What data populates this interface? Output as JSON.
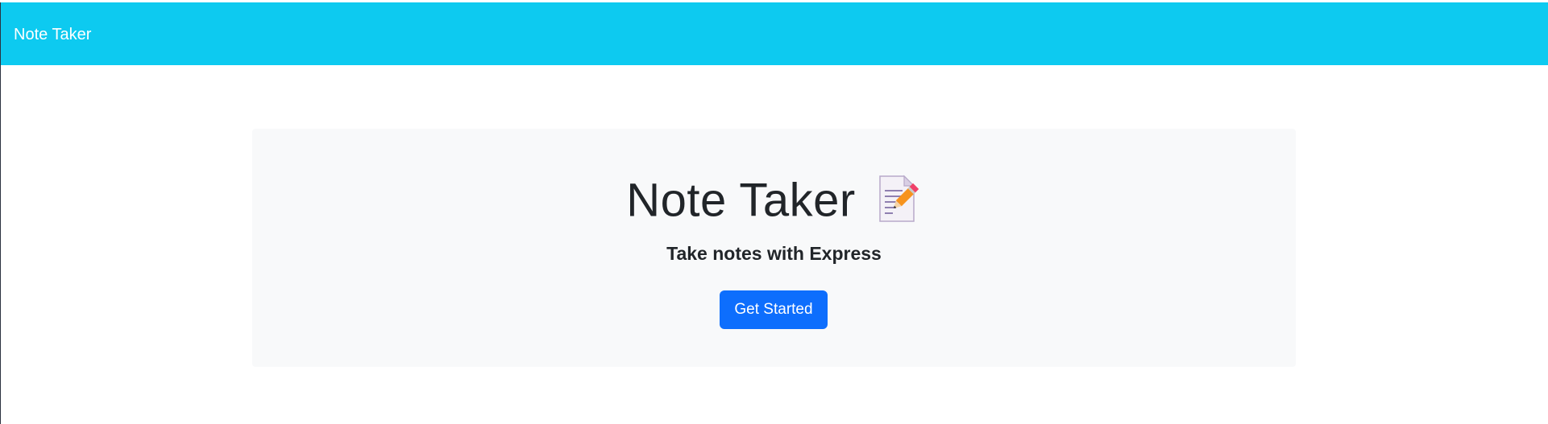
{
  "navbar": {
    "brand": "Note Taker"
  },
  "hero": {
    "title": "Note Taker",
    "title_icon": "memo-icon",
    "subtitle": "Take notes with Express",
    "cta_label": "Get Started"
  },
  "colors": {
    "navbar_bg": "#0dcaf0",
    "jumbotron_bg": "#f8f9fa",
    "button_bg": "#0d6efd",
    "text": "#212529"
  }
}
